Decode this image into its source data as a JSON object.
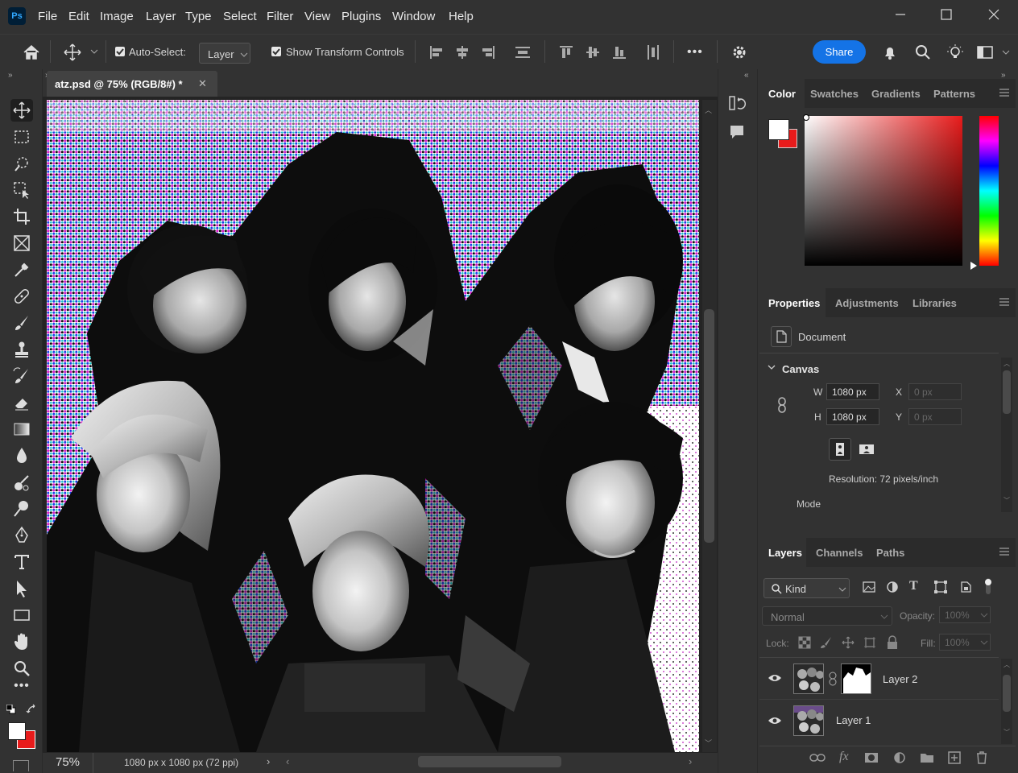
{
  "app": {
    "logo": "Ps"
  },
  "menu": [
    "File",
    "Edit",
    "Image",
    "Layer",
    "Type",
    "Select",
    "Filter",
    "View",
    "Plugins",
    "Window",
    "Help"
  ],
  "options": {
    "auto_select_label": "Auto-Select:",
    "auto_select_value": "Layer",
    "transform_label": "Show Transform Controls",
    "more": "•••",
    "share": "Share"
  },
  "document": {
    "tab_title": "atz.psd @ 75% (RGB/8#) *",
    "zoom": "75%",
    "info": "1080 px x 1080 px (72 ppi)"
  },
  "color_panel": {
    "tabs": [
      "Color",
      "Swatches",
      "Gradients",
      "Patterns"
    ],
    "active": "Color"
  },
  "properties_panel": {
    "tabs": [
      "Properties",
      "Adjustments",
      "Libraries"
    ],
    "doc_label": "Document",
    "section": "Canvas",
    "w_label": "W",
    "w_value": "1080 px",
    "h_label": "H",
    "h_value": "1080 px",
    "x_label": "X",
    "x_value": "0 px",
    "y_label": "Y",
    "y_value": "0 px",
    "resolution": "Resolution: 72 pixels/inch",
    "mode": "Mode"
  },
  "layers_panel": {
    "tabs": [
      "Layers",
      "Channels",
      "Paths"
    ],
    "filter": "Kind",
    "blend": "Normal",
    "opacity_label": "Opacity:",
    "opacity_value": "100%",
    "lock_label": "Lock:",
    "fill_label": "Fill:",
    "fill_value": "100%",
    "layers": [
      "Layer 2",
      "Layer 1"
    ]
  },
  "colors": {
    "accent": "#1473e6",
    "background_swatch": "#e81b1b",
    "foreground_swatch": "#ffffff"
  }
}
